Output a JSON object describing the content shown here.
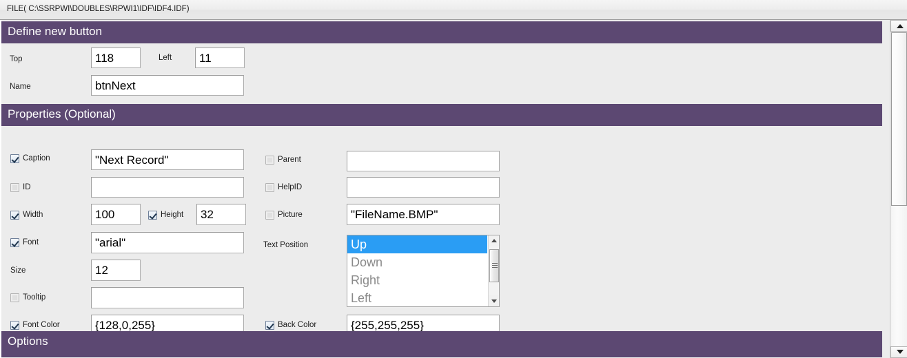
{
  "window": {
    "file_bar_text": "FILE( C:\\SSRPWI\\DOUBLES\\RPWI1\\IDF\\IDF4.IDF)"
  },
  "sections": {
    "define": {
      "title": "Define new button"
    },
    "properties": {
      "title": "Properties (Optional)"
    },
    "options": {
      "title": "Options"
    }
  },
  "define_fields": {
    "top_label": "Top",
    "top_value": "118",
    "left_label": "Left",
    "left_value": "11",
    "name_label": "Name",
    "name_value": "btnNext"
  },
  "properties_left": {
    "caption": {
      "label": "Caption",
      "checked": true,
      "value": "\"Next Record\""
    },
    "id": {
      "label": "ID",
      "checked": false,
      "value": ""
    },
    "width": {
      "label": "Width",
      "checked": true,
      "value": "100"
    },
    "height": {
      "label": "Height",
      "checked": true,
      "value": "32"
    },
    "font": {
      "label": "Font",
      "checked": true,
      "value": "\"arial\""
    },
    "size": {
      "label": "Size",
      "value": "12"
    },
    "tooltip": {
      "label": "Tooltip",
      "checked": false,
      "value": ""
    },
    "font_color": {
      "label": "Font Color",
      "checked": true,
      "value": "{128,0,255}"
    }
  },
  "properties_right": {
    "parent": {
      "label": "Parent",
      "checked": false,
      "value": ""
    },
    "helpid": {
      "label": "HelpID",
      "checked": false,
      "value": ""
    },
    "picture": {
      "label": "Picture",
      "checked": false,
      "value": "\"FileName.BMP\""
    },
    "text_position": {
      "label": "Text Position",
      "options": [
        "Up",
        "Down",
        "Right",
        "Left"
      ],
      "selected": "Up"
    },
    "back_color": {
      "label": "Back Color",
      "checked": true,
      "value": "{255,255,255}"
    }
  },
  "colors": {
    "header_purple": "#5c4872",
    "selection_blue": "#2a9df4",
    "panel_gray": "#ececec"
  }
}
